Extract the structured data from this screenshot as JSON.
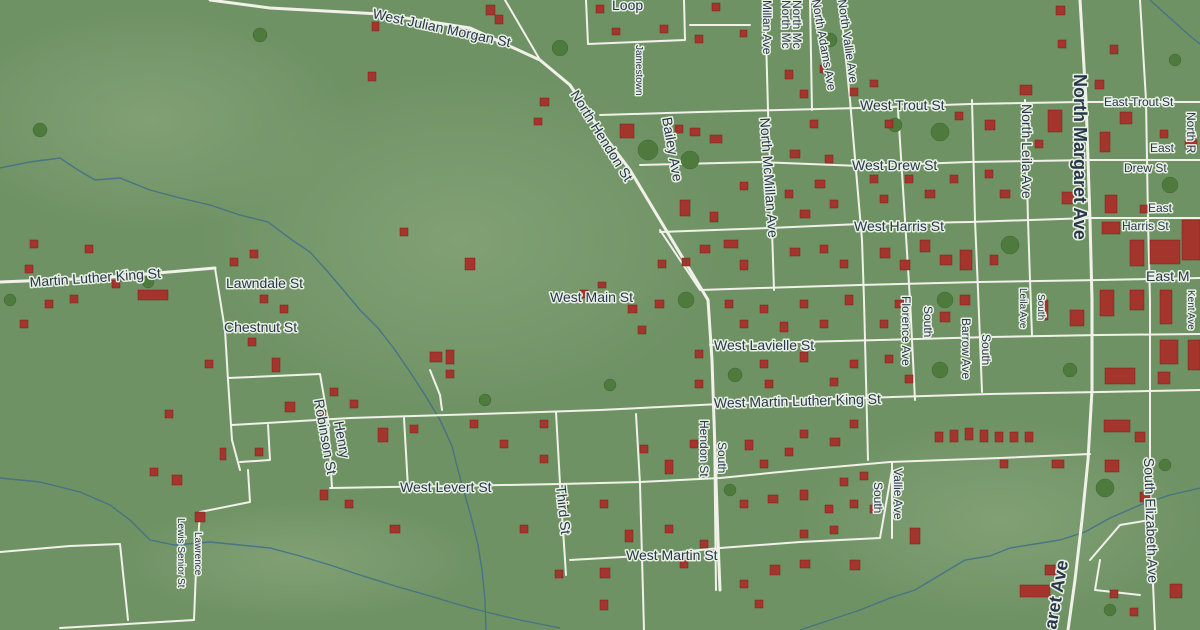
{
  "map": {
    "colors": {
      "land": "#6f9265",
      "land_light": "#86a579",
      "road": "#f1f1ea",
      "building": "#a3352c",
      "water": "#3f6f88",
      "label_text": "#27364a",
      "tree": "#4f7a3d"
    },
    "streets": {
      "west_julian_morgan": "West Julian Morgan St",
      "loop": "Loop",
      "jamestown": "Jamestown",
      "north_mc_a": "North Mc",
      "north_mc_b": "North Mc",
      "millan_ave": "Millan Ave",
      "north_adams": "North Adams Ave",
      "north_vallie": "North Vallie Ave",
      "north_hendon": "North Hendon St",
      "bailey_ave": "Bailey Ave",
      "north_mcmillan": "North McMillan Ave",
      "west_trout": "West Trout St",
      "west_drew": "West Drew St",
      "west_harris": "West Harris St",
      "north_leila": "North Leila Ave",
      "north_margaret": "North Margaret Ave",
      "east_trout": "East Trout St",
      "east_drew_1": "East",
      "east_drew_2": "Drew St",
      "east_harris_1": "East",
      "east_harris_2": "Harris St",
      "east_main": "East M",
      "north_r": "North R",
      "martin_luther_king": "Martin Luther King St",
      "lawndale": "Lawndale St",
      "chestnut": "Chestnut St",
      "west_main": "West Main St",
      "florence_ave": "Florence Ave",
      "south_barrow_1": "South",
      "south_barrow_2": "Barrow Ave",
      "south_1": "South",
      "south_2": "South",
      "leila_ave": "Leila Ave",
      "south_3": "South",
      "kent_ave": "Kent Ave",
      "west_lavielle": "West Lavielle St",
      "west_mlk": "West Martin Luther King St",
      "henry_1": "Henry",
      "robinson_st": "Robinson St",
      "west_levert": "West Levert St",
      "hendon_south_1": "South",
      "hendon_south_2": "Hendon St",
      "third_st": "Third St",
      "south_vallie_1": "South",
      "south_vallie_2": "Vallie Ave",
      "west_martin": "West Martin St",
      "lewis_senior": "Lewis Senior St",
      "lawrence": "Lawrence",
      "margaret_ave_south": "aret Ave",
      "south_elizabeth": "South Elizabeth Ave"
    }
  }
}
